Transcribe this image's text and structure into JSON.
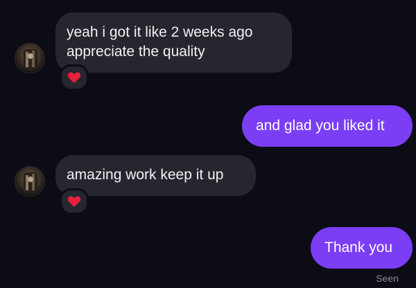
{
  "messages": [
    {
      "direction": "incoming",
      "lines": [
        "yeah i got it like 2 weeks ago",
        "appreciate the quality"
      ],
      "reaction": "heart-icon"
    },
    {
      "direction": "outgoing",
      "text": "and glad you liked it"
    },
    {
      "direction": "incoming",
      "lines": [
        "amazing work keep it up"
      ],
      "reaction": "heart-icon"
    },
    {
      "direction": "outgoing",
      "text": "Thank you"
    }
  ],
  "status": {
    "seen_label": "Seen"
  },
  "colors": {
    "background": "#0c0c14",
    "incoming_bubble": "#26262e",
    "outgoing_bubble": "#7b3ef5",
    "reaction_heart": "#e8213a",
    "seen_text": "#8a8a92"
  }
}
